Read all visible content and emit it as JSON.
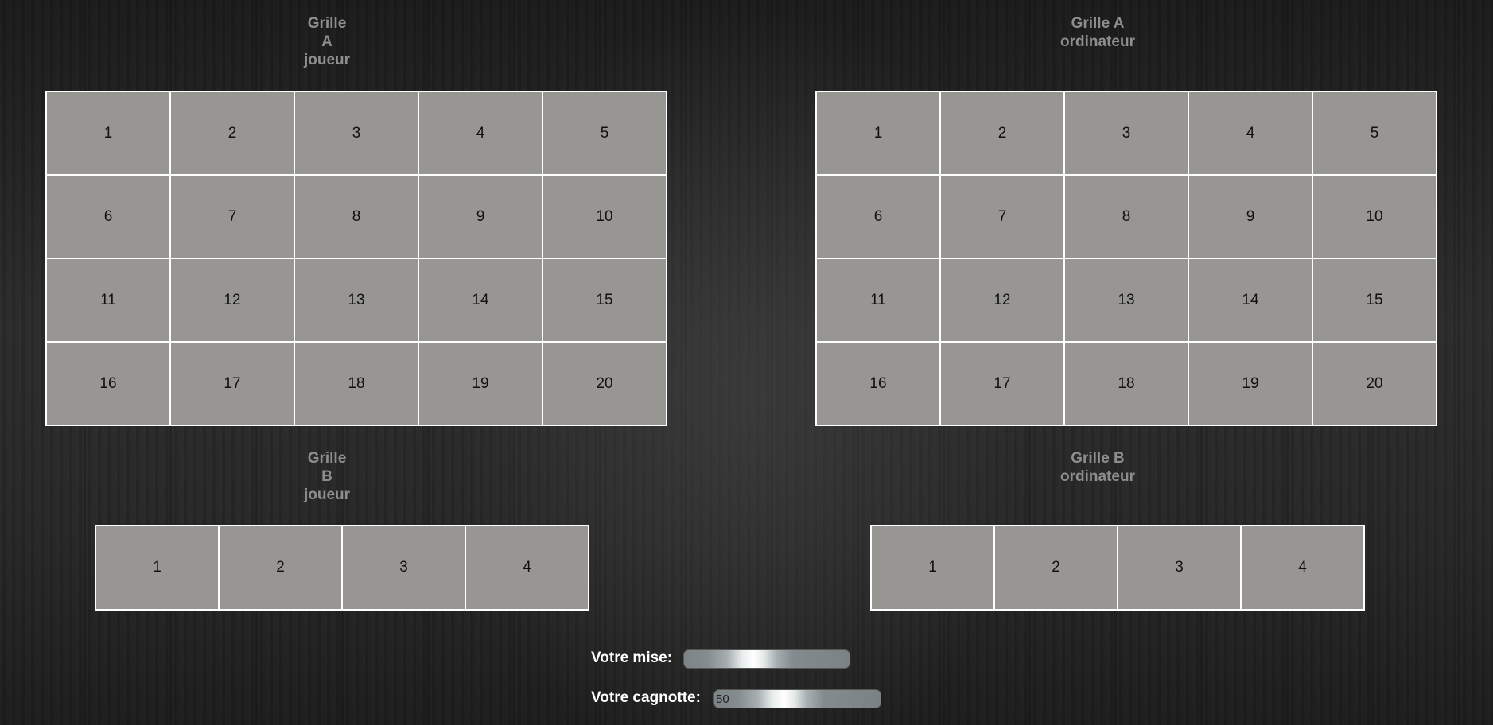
{
  "player": {
    "grid_a_title": [
      "Grille",
      "A",
      "joueur"
    ],
    "grid_b_title": [
      "Grille",
      "B",
      "joueur"
    ],
    "grid_a_cells": [
      [
        "1",
        "2",
        "3",
        "4",
        "5"
      ],
      [
        "6",
        "7",
        "8",
        "9",
        "10"
      ],
      [
        "11",
        "12",
        "13",
        "14",
        "15"
      ],
      [
        "16",
        "17",
        "18",
        "19",
        "20"
      ]
    ],
    "grid_b_cells": [
      "1",
      "2",
      "3",
      "4"
    ]
  },
  "computer": {
    "grid_a_title": [
      "Grille A",
      "ordinateur"
    ],
    "grid_b_title": [
      "Grille B",
      "ordinateur"
    ],
    "grid_a_cells": [
      [
        "1",
        "2",
        "3",
        "4",
        "5"
      ],
      [
        "6",
        "7",
        "8",
        "9",
        "10"
      ],
      [
        "11",
        "12",
        "13",
        "14",
        "15"
      ],
      [
        "16",
        "17",
        "18",
        "19",
        "20"
      ]
    ],
    "grid_b_cells": [
      "1",
      "2",
      "3",
      "4"
    ]
  },
  "controls": {
    "bet_label": "Votre mise:",
    "bet_value": "",
    "jackpot_label": "Votre cagnotte:",
    "jackpot_value": "50"
  },
  "colors": {
    "cell_background": "#979692",
    "cell_border": "#ffffff",
    "title_text": "#8e8e8e",
    "label_text": "#ffffff"
  }
}
